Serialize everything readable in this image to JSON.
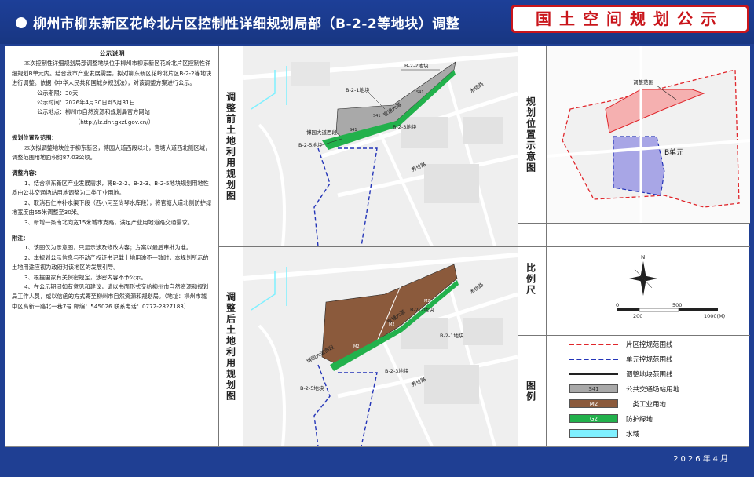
{
  "header": {
    "title": "柳州市柳东新区花岭北片区控制性详细规划局部（B-2-2等地块）调整",
    "banner": "国土空间规划公示"
  },
  "notice": {
    "title": "公示说明",
    "p1": "本次控制性详细规划局部调整地块位于柳州市柳东新区花岭北片区控制性详细规划B单元内。结合我市产业发展需要，拟对柳东新区花岭北片区B-2-2等地块进行调整。依据《中华人民共和国城乡规划法》，对该调整方案进行公示。",
    "period": "公示期限：30天",
    "time": "公示时间：2026年4月30日到5月31日",
    "place": "公示地点：柳州市自然资源和规划局官方网站",
    "url": "（http://lz.dnr.gxzf.gov.cn/）",
    "sec1": "规划位置及范围：",
    "p2": "本次拟调整地块位于柳东新区，博园大道西段以北，官塘大道西北侧区域，调整范围用地面积约87.03公顷。",
    "sec2": "调整内容：",
    "c1": "1、结合柳东新区产业发展需求，将B-2-2、B-2-3、B-2-5地块规划用地性质由公共交通场站用地调整为二类工业用地。",
    "c2": "2、取消石仁冲补水渠下段（西小河至尚琴水库段），将官塘大道北侧防护绿地宽度由55米调整至30米。",
    "c3": "3、新增一条南北向宽15米城市支路，满足产业用地道路交通需求。",
    "sec3": "附注：",
    "n1": "1、该图仅为示意图，只显示涉及修改内容；方案以最后审批为准。",
    "n2": "2、本规划公示信息与不动产权证书记载土地用途不一致时，本规划所示的土地用途应视为政府对该地区的发展引导。",
    "n3": "3、根据国家有关保密规定，涉密内容不予公示。",
    "n4": "4、在公示期间如有意见和建议，请以书面形式交给柳州市自然资源和规划局工作人员，或以信函的方式寄至柳州市自然资源和规划局。（地址：柳州市城中区高新一路北一巷7号  邮编：545026  联系电话：0772-2827183）"
  },
  "labels": {
    "before": "调整前土地利用规划图",
    "after": "调整后土地利用规划图",
    "location": "规划位置示意图",
    "scale": "比例尺",
    "legend": "图例"
  },
  "map_before": {
    "b22": "B-2-2地块",
    "b21": "B-2-1地块",
    "b23": "B-2-3地块",
    "b25": "B-2-5地块",
    "road1": "博园大道西段",
    "road2": "木桃路",
    "road3": "秀竹路",
    "road4": "官塘大道",
    "s41a": "S41",
    "s41b": "S41",
    "s41c": "S41"
  },
  "map_after": {
    "b22": "B-2-2地块",
    "b21": "B-2-1地块",
    "b23": "B-2-3地块",
    "b25": "B-2-5地块",
    "road1": "博园大道西段",
    "road2": "木桃路",
    "road3": "秀竹路",
    "road4": "官塘大道",
    "m2a": "M2",
    "m2b": "M2",
    "m2c": "M2"
  },
  "location_map": {
    "range": "调整范围",
    "unit": "B单元"
  },
  "scale": {
    "n": "N",
    "t0": "0",
    "t1": "200",
    "t2": "500",
    "t3": "1000(M)"
  },
  "legend": {
    "items": [
      {
        "sym": "",
        "text": "片区控规范围线"
      },
      {
        "sym": "",
        "text": "单元控规范围线"
      },
      {
        "sym": "",
        "text": "调整地块范围线"
      },
      {
        "sym": "S41",
        "text": "公共交通场站用地"
      },
      {
        "sym": "M2",
        "text": "二类工业用地"
      },
      {
        "sym": "G2",
        "text": "防护绿地"
      },
      {
        "sym": "",
        "text": "水域"
      }
    ]
  },
  "footer": {
    "date": "2026年4月"
  },
  "colors": {
    "header_bg": "#1d3f98",
    "banner_red": "#c9151b",
    "s41": "#a9a9a9",
    "m2": "#8b5a3c",
    "g2": "#22b14c",
    "water": "#7ff0ff",
    "red_dash": "#e0262b",
    "blue_dash": "#2334b8"
  }
}
